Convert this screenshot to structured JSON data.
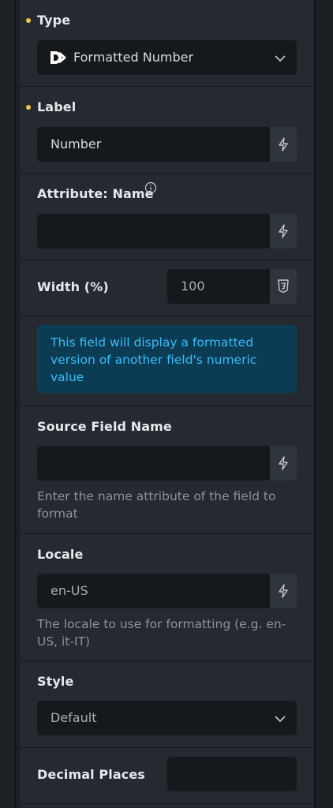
{
  "type_section": {
    "label": "Type",
    "value": "Formatted Number"
  },
  "label_section": {
    "label": "Label",
    "value": "Number"
  },
  "attribute_section": {
    "label": "Attribute: Name",
    "value": ""
  },
  "width_section": {
    "label": "Width (%)",
    "placeholder": "100"
  },
  "notice": {
    "text": "This field will display a formatted version of another field's numeric value"
  },
  "source_section": {
    "label": "Source Field Name",
    "value": "",
    "helper": "Enter the name attribute of the field to format"
  },
  "locale_section": {
    "label": "Locale",
    "placeholder": "en-US",
    "helper": "The locale to use for formatting (e.g. en-US, it-IT)"
  },
  "style_section": {
    "label": "Style",
    "value": "Default"
  },
  "decimal_section": {
    "label": "Decimal Places",
    "value": ""
  },
  "colors": {
    "required_dot": "#f5c542",
    "notice_bg": "#0c3c54",
    "notice_text": "#38bdf8"
  }
}
